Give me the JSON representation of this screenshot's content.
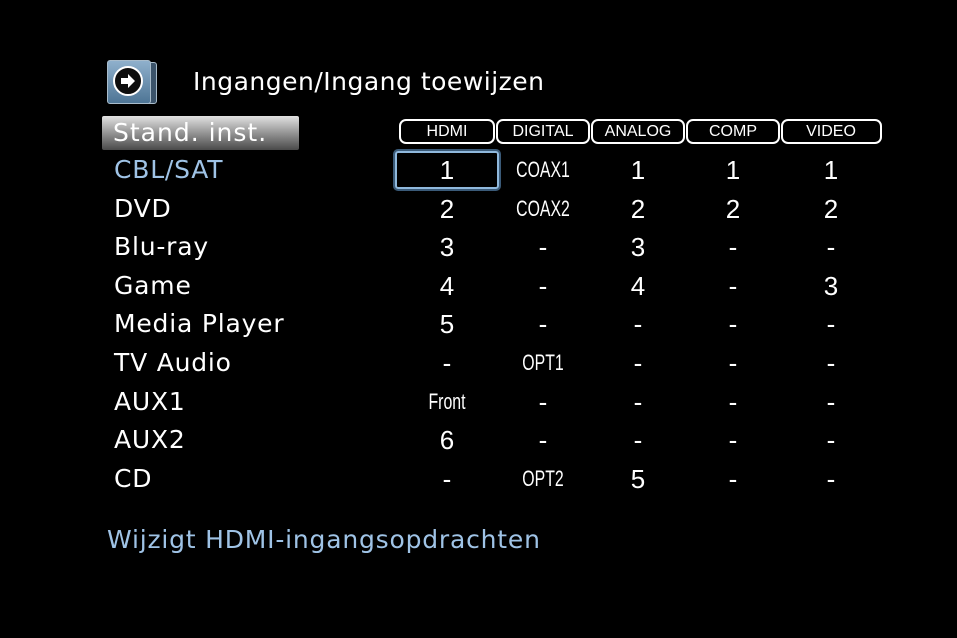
{
  "header": {
    "title": "Ingangen/Ingang toewijzen",
    "icon": "menu-arrow-icon"
  },
  "default_button": "Stand. inst.",
  "columns": [
    "HDMI",
    "DIGITAL",
    "ANALOG",
    "COMP",
    "VIDEO"
  ],
  "rows": [
    {
      "label": "CBL/SAT",
      "cells": [
        "1",
        "COAX1",
        "1",
        "1",
        "1"
      ]
    },
    {
      "label": "DVD",
      "cells": [
        "2",
        "COAX2",
        "2",
        "2",
        "2"
      ]
    },
    {
      "label": "Blu-ray",
      "cells": [
        "3",
        "-",
        "3",
        "-",
        "-"
      ]
    },
    {
      "label": "Game",
      "cells": [
        "4",
        "-",
        "4",
        "-",
        "3"
      ]
    },
    {
      "label": "Media Player",
      "cells": [
        "5",
        "-",
        "-",
        "-",
        "-"
      ]
    },
    {
      "label": "TV Audio",
      "cells": [
        "-",
        "OPT1",
        "-",
        "-",
        "-"
      ]
    },
    {
      "label": "AUX1",
      "cells": [
        "Front",
        "-",
        "-",
        "-",
        "-"
      ]
    },
    {
      "label": "AUX2",
      "cells": [
        "6",
        "-",
        "-",
        "-",
        "-"
      ]
    },
    {
      "label": "CD",
      "cells": [
        "-",
        "OPT2",
        "5",
        "-",
        "-"
      ]
    }
  ],
  "hint": "Wijzigt HDMI-ingangsopdrachten",
  "colors": {
    "background": "#000000",
    "selected": "#9fc3e6",
    "focus": "#8fb8dc"
  }
}
